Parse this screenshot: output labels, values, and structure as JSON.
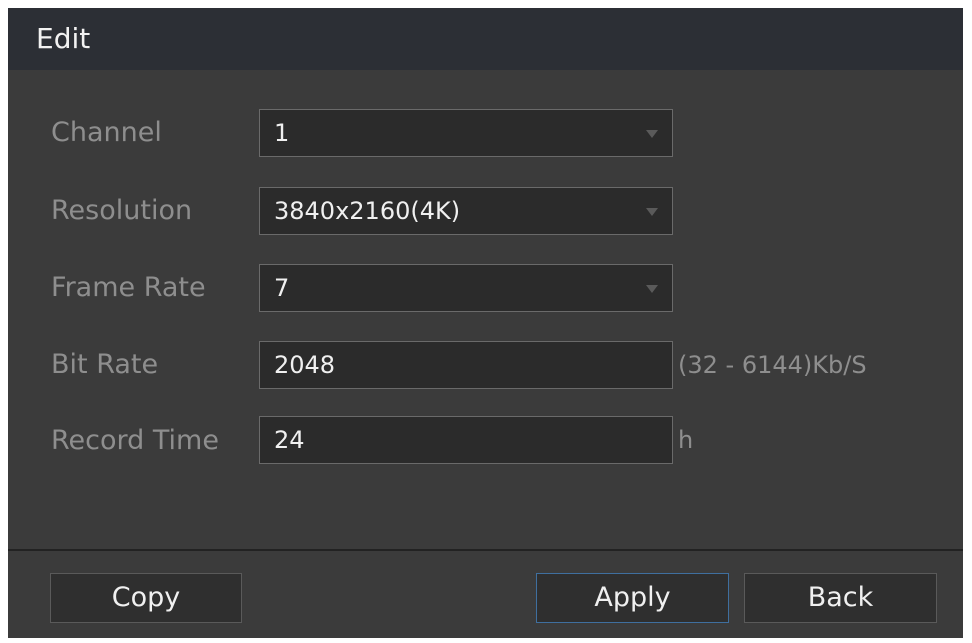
{
  "dialog": {
    "title": "Edit"
  },
  "form": {
    "channel": {
      "label": "Channel",
      "value": "1"
    },
    "resolution": {
      "label": "Resolution",
      "value": "3840x2160(4K)"
    },
    "frame_rate": {
      "label": "Frame Rate",
      "value": "7"
    },
    "bit_rate": {
      "label": "Bit Rate",
      "value": "2048",
      "suffix": "(32 - 6144)Kb/S"
    },
    "record_time": {
      "label": "Record Time",
      "value": "24",
      "suffix": "h"
    }
  },
  "buttons": {
    "copy": "Copy",
    "apply": "Apply",
    "back": "Back"
  },
  "icons": {
    "dropdown": "chevron-down-icon"
  },
  "colors": {
    "background": "#3b3b3b",
    "titlebar": "#2c2f35",
    "label": "#8e8e8e",
    "field_bg": "#2b2b2b",
    "field_border": "#6a6a6a",
    "focus_border": "#3f6f9f"
  }
}
